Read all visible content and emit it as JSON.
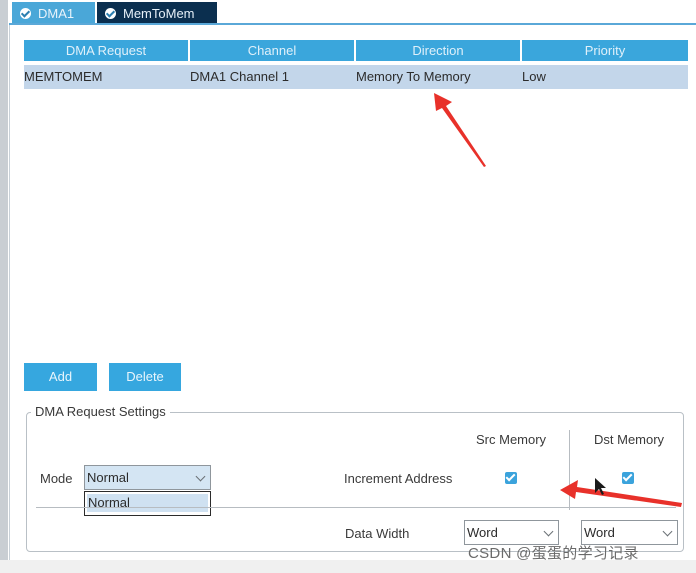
{
  "tabs": [
    {
      "label": "DMA1"
    },
    {
      "label": "MemToMem"
    }
  ],
  "table": {
    "headers": [
      "DMA Request",
      "Channel",
      "Direction",
      "Priority"
    ],
    "rows": [
      [
        "MEMTOMEM",
        "DMA1 Channel 1",
        "Memory To Memory",
        "Low"
      ]
    ]
  },
  "buttons": {
    "add": "Add",
    "delete": "Delete"
  },
  "settings": {
    "legend": "DMA Request Settings",
    "src_memory": "Src Memory",
    "dst_memory": "Dst Memory",
    "mode_label": "Mode",
    "mode_value": "Normal",
    "mode_options": [
      "Normal"
    ],
    "increment_address": "Increment Address",
    "increment_src_checked": true,
    "increment_dst_checked": true,
    "data_width_label": "Data Width",
    "src_data_width": "Word",
    "dst_data_width": "Word"
  },
  "watermark": "CSDN @蛋蛋的学习记录",
  "colors": {
    "accent": "#3aa6dc",
    "tab_active": "#0b2f4f",
    "row_selected": "#c3d6ea",
    "annotation_red": "#e8312a"
  }
}
